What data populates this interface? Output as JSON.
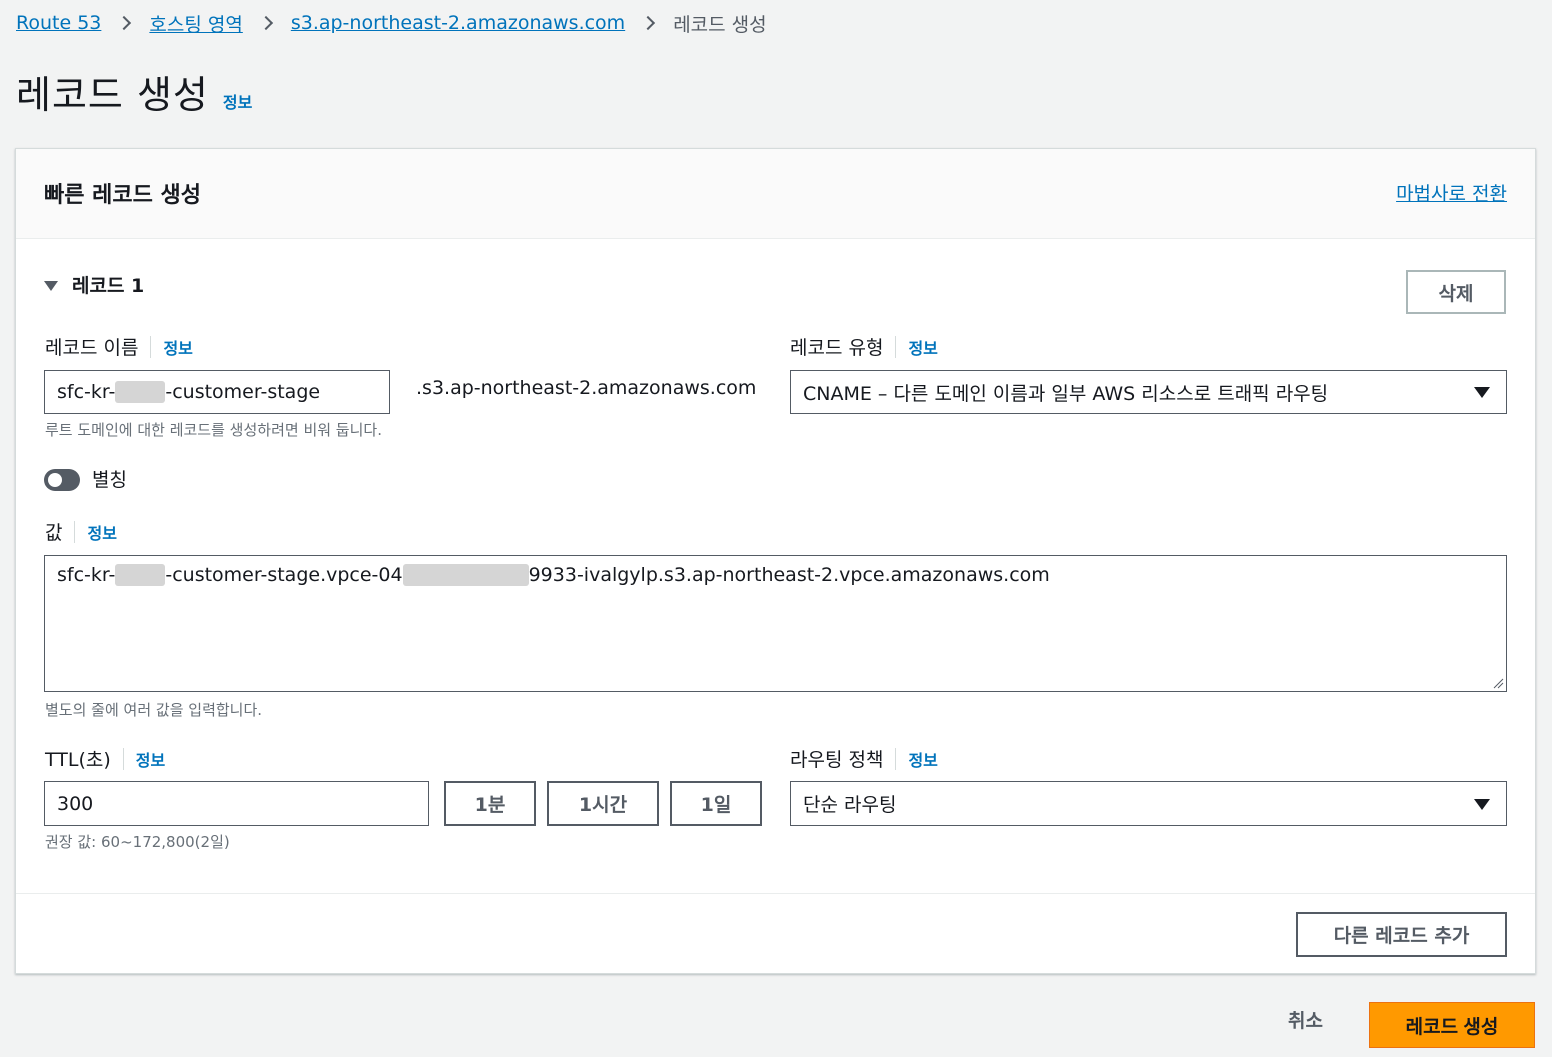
{
  "breadcrumb": {
    "items": [
      "Route 53",
      "호스팅 영역",
      "s3.ap-northeast-2.amazonaws.com"
    ],
    "current": "레코드 생성"
  },
  "page": {
    "title": "레코드 생성",
    "info": "정보"
  },
  "panel": {
    "title": "빠른 레코드 생성",
    "wizard_link": "마법사로 전환",
    "record_section": "레코드 1",
    "delete_button": "삭제",
    "record_name": {
      "label": "레코드 이름",
      "info": "정보",
      "value_prefix": "sfc-kr-",
      "value_suffix": "-customer-stage",
      "domain_suffix": ".s3.ap-northeast-2.amazonaws.com",
      "hint": "루트 도메인에 대한 레코드를 생성하려면 비워 둡니다."
    },
    "record_type": {
      "label": "레코드 유형",
      "info": "정보",
      "selected": "CNAME – 다른 도메인 이름과 일부 AWS 리소스로 트래픽 라우팅"
    },
    "alias": {
      "label": "별칭",
      "enabled": false
    },
    "value": {
      "label": "값",
      "info": "정보",
      "part1": "sfc-kr-",
      "part2": "-customer-stage.vpce-04",
      "part3": "9933-ivalgylp.s3.ap-northeast-2.vpce.amazonaws.com",
      "hint": "별도의 줄에 여러 값을 입력합니다."
    },
    "ttl": {
      "label": "TTL(초)",
      "info": "정보",
      "value": "300",
      "presets": [
        "1분",
        "1시간",
        "1일"
      ],
      "hint": "권장 값: 60~172,800(2일)"
    },
    "routing_policy": {
      "label": "라우팅 정책",
      "info": "정보",
      "selected": "단순 라우팅"
    },
    "add_record_button": "다른 레코드 추가"
  },
  "footer": {
    "cancel": "취소",
    "submit": "레코드 생성"
  },
  "colors": {
    "link": "#0073bb",
    "primary": "#ff9900",
    "background": "#f2f3f3"
  }
}
